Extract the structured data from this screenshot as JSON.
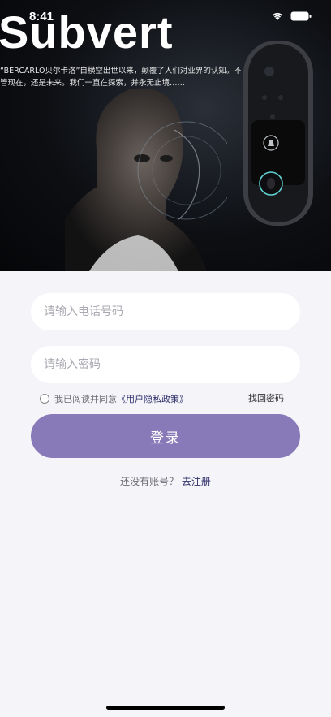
{
  "status_bar": {
    "time": "8:41",
    "wifi_icon": "wifi-icon",
    "battery_icon": "battery-icon"
  },
  "hero": {
    "brand": "Subvert",
    "description": "“BERCARLO贝尔卡洛”自横空出世以来，颠覆了人们对业界的认知。不管现在，还是未来。我们一直在探索，并永无止境……",
    "image_face": "person-face-image",
    "image_device": "smart-doorbell-image"
  },
  "form": {
    "phone_placeholder": "请输入电话号码",
    "phone_value": "",
    "password_placeholder": "请输入密码",
    "password_value": "",
    "agree_prefix": "我已阅读并同意",
    "policy_link": "《用户隐私政策》",
    "forgot_password": "找回密码",
    "login_button": "登录"
  },
  "register": {
    "prompt": "还没有账号？",
    "link": "去注册"
  },
  "colors": {
    "accent": "#8879b8",
    "link": "#2f2f6b",
    "background": "#f4f4f9"
  }
}
